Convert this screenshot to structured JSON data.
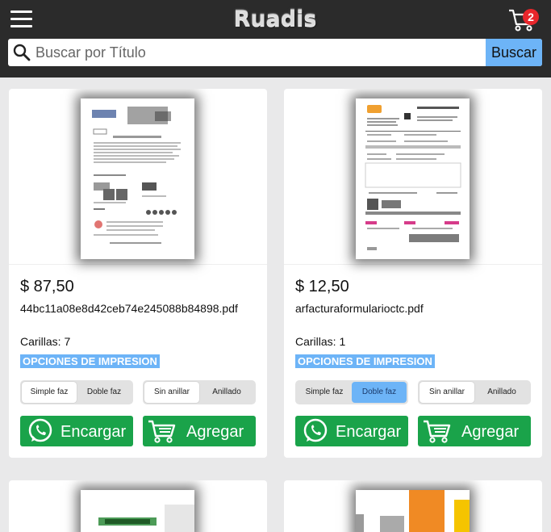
{
  "header": {
    "logo_text": "Ruadis",
    "cart_count": "2"
  },
  "search": {
    "placeholder": "Buscar por Título",
    "button_label": "Buscar"
  },
  "products": [
    {
      "price": "$ 87,50",
      "filename": "44bc11a08e8d42ceb74e245088b84898.pdf",
      "pages": "Carillas: 7",
      "options_label": "OPCIONES DE IMPRESION",
      "sides": [
        "Simple faz",
        "Doble faz"
      ],
      "sides_selected": "Simple faz",
      "binding": [
        "Sin anillar",
        "Anillado"
      ],
      "binding_selected": "Sin anillar",
      "order_label": "Encargar",
      "add_label": "Agregar"
    },
    {
      "price": "$ 12,50",
      "filename": "arfacturaformularioctc.pdf",
      "pages": "Carillas: 1",
      "options_label": "OPCIONES DE IMPRESION",
      "sides": [
        "Simple faz",
        "Doble faz"
      ],
      "sides_selected": "Doble faz",
      "binding": [
        "Sin anillar",
        "Anillado"
      ],
      "binding_selected": "Sin anillar",
      "order_label": "Encargar",
      "add_label": "Agregar"
    }
  ],
  "colors": {
    "topbar": "#2b2b2b",
    "accent_blue": "#6db4f7",
    "action_green": "#1aa34a",
    "badge_red": "#e8262b"
  },
  "icons": [
    "menu-icon",
    "cart-icon",
    "search-icon",
    "whatsapp-icon",
    "cart-add-icon"
  ]
}
